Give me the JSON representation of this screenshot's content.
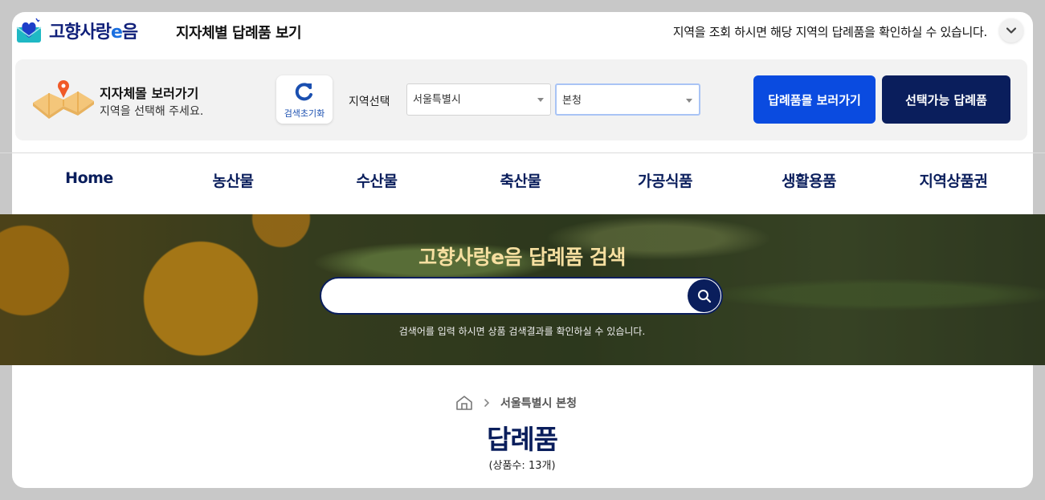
{
  "header": {
    "logo_text_a": "고향사랑",
    "logo_text_e": "e",
    "logo_text_b": "음",
    "modal_title": "지자체별 답례품 보기",
    "notice": "지역을 조회 하시면 해당 지역의 답례품을 확인하실 수 있습니다."
  },
  "region_panel": {
    "title": "지자체몰 보러가기",
    "subtitle": "지역을 선택해 주세요.",
    "reset_label": "검색초기화",
    "region_label": "지역선택",
    "city_value": "서울특별시",
    "district_value": "본청",
    "mall_button": "답례품몰 보러가기",
    "available_button": "선택가능 답례품"
  },
  "nav": {
    "items": [
      "Home",
      "농산물",
      "수산물",
      "축산물",
      "가공식품",
      "생활용품",
      "지역상품권"
    ]
  },
  "hero": {
    "title": "고향사랑e음 답례품 검색",
    "search_value": "",
    "hint": "검색어를 입력 하시면 상품 검색결과를 확인하실 수 있습니다."
  },
  "content": {
    "breadcrumb": "서울특별시 본청",
    "title": "답례품",
    "count": "(상품수: 13개)"
  }
}
